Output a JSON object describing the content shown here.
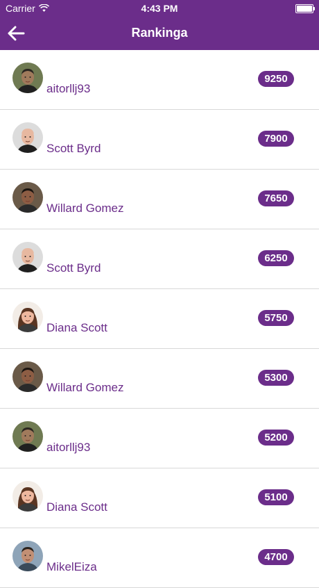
{
  "status_bar": {
    "carrier": "Carrier",
    "time": "4:43 PM"
  },
  "nav": {
    "title": "Rankinga",
    "back_icon": "arrow-left-icon"
  },
  "colors": {
    "accent": "#6b2d8a",
    "separator": "#d8d8d8"
  },
  "rankings": [
    {
      "name": "aitorllj93",
      "score": "9250",
      "avatar_variant": "man-dark-olive"
    },
    {
      "name": "Scott Byrd",
      "score": "7900",
      "avatar_variant": "man-bald-light"
    },
    {
      "name": "Willard Gomez",
      "score": "7650",
      "avatar_variant": "man-dark-beard"
    },
    {
      "name": "Scott Byrd",
      "score": "6250",
      "avatar_variant": "man-bald-light"
    },
    {
      "name": "Diana Scott",
      "score": "5750",
      "avatar_variant": "woman-brown-hair"
    },
    {
      "name": "Willard Gomez",
      "score": "5300",
      "avatar_variant": "man-dark-beard"
    },
    {
      "name": "aitorllj93",
      "score": "5200",
      "avatar_variant": "man-dark-olive"
    },
    {
      "name": "Diana Scott",
      "score": "5100",
      "avatar_variant": "woman-brown-hair"
    },
    {
      "name": "MikelEiza",
      "score": "4700",
      "avatar_variant": "man-dark-hair"
    }
  ]
}
